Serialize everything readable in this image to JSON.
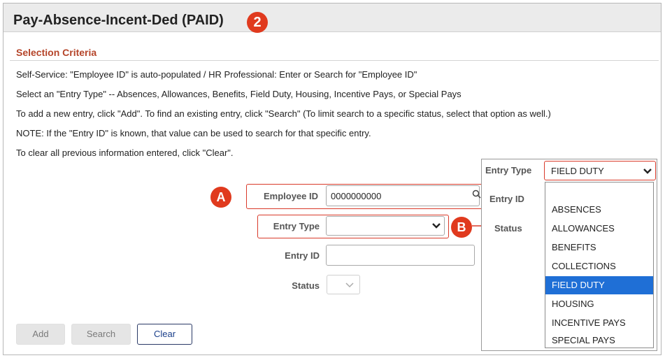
{
  "window": {
    "title": "Pay-Absence-Incent-Ded (PAID)",
    "step": "2"
  },
  "section_title": "Selection Criteria",
  "instructions": [
    "Self-Service: \"Employee ID\" is auto-populated / HR Professional: Enter or Search for \"Employee ID\"",
    "Select an \"Entry Type\" -- Absences, Allowances, Benefits, Field Duty, Housing, Incentive Pays, or Special Pays",
    "To add a new entry, click \"Add\". To find an existing entry, click \"Search\" (To limit search to a specific status, select that option as well.)",
    "NOTE: If the \"Entry ID\" is known, that value can be used to search for that specific entry.",
    "To clear all previous information entered, click \"Clear\"."
  ],
  "form": {
    "employee_id": {
      "label": "Employee ID",
      "value": "0000000000"
    },
    "entry_type": {
      "label": "Entry Type",
      "value": ""
    },
    "entry_id": {
      "label": "Entry ID",
      "value": ""
    },
    "status": {
      "label": "Status",
      "value": ""
    }
  },
  "buttons": {
    "add": "Add",
    "search": "Search",
    "clear": "Clear"
  },
  "callouts": {
    "a": "A",
    "b": "B"
  },
  "popup": {
    "entry_type_label": "Entry Type",
    "entry_type_value": "FIELD DUTY",
    "entry_id_label": "Entry ID",
    "status_label": "Status",
    "options": [
      "ABSENCES",
      "ALLOWANCES",
      "BENEFITS",
      "COLLECTIONS",
      "FIELD DUTY",
      "HOUSING",
      "INCENTIVE PAYS",
      "SPECIAL PAYS"
    ],
    "selected_option": "FIELD DUTY"
  },
  "colors": {
    "accent_red": "#e03a1e",
    "section_text": "#b5452a",
    "selection_blue": "#1f6fd6",
    "link_blue": "#1a3f8a"
  }
}
